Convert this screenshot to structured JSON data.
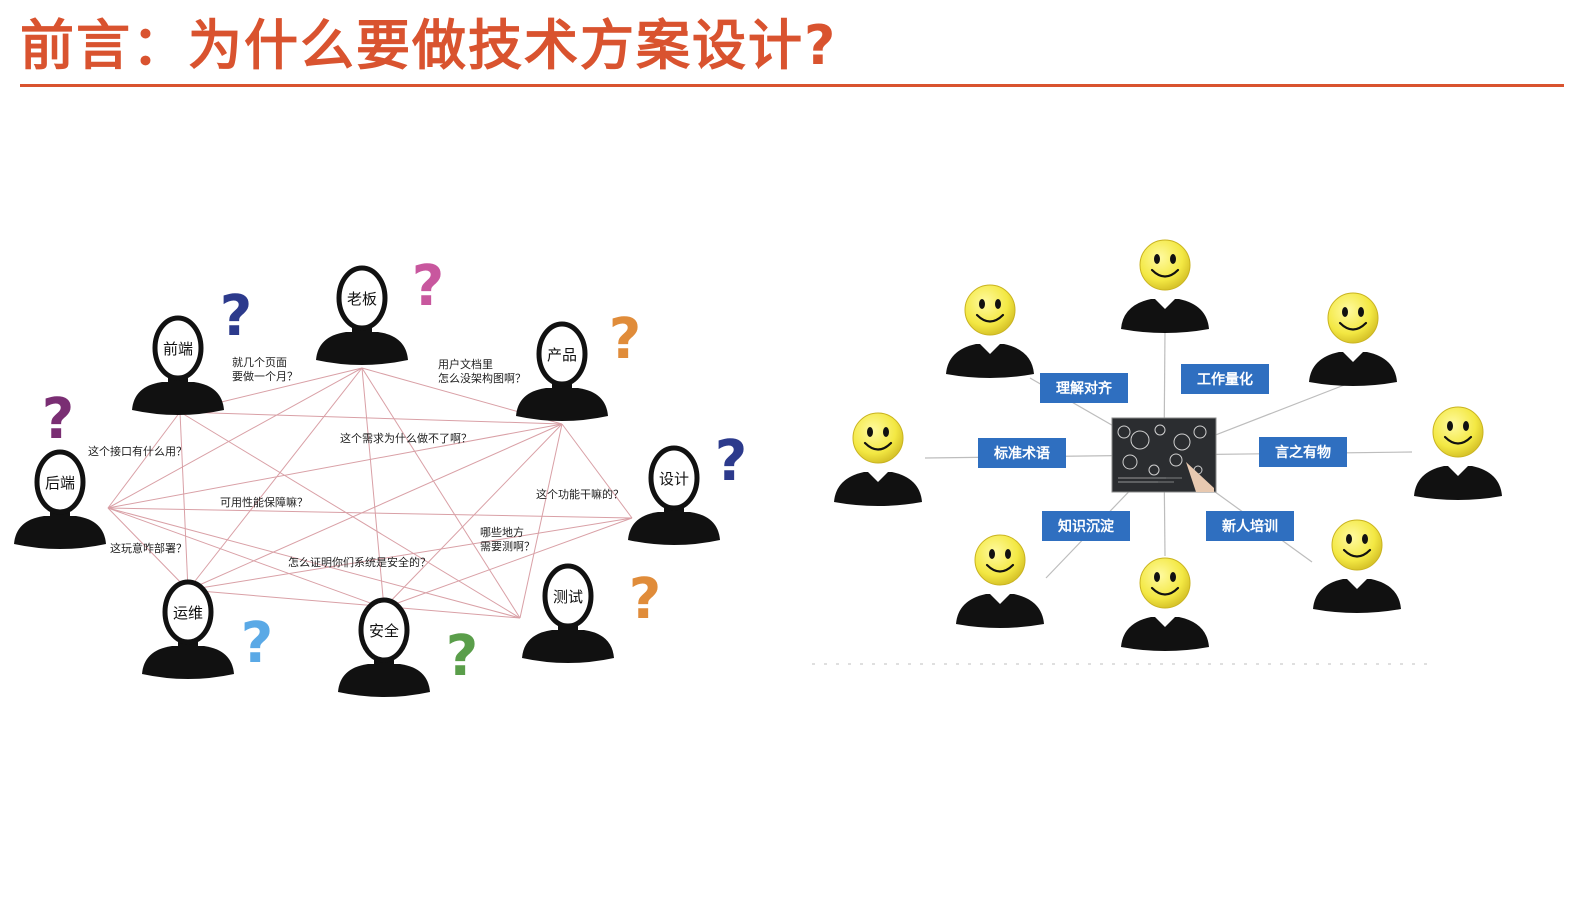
{
  "title": "前言：为什么要做技术方案设计?",
  "colors": {
    "title": "#d9532f",
    "line": "#d9a0a6",
    "tag_bg": "#2f6fc0",
    "smiley": "#f3e843"
  },
  "left_diagram": {
    "roles": [
      {
        "id": "boss",
        "label": "老板",
        "q_color": "#c8579e"
      },
      {
        "id": "frontend",
        "label": "前端",
        "q_color": "#2c3a8c"
      },
      {
        "id": "product",
        "label": "产品",
        "q_color": "#e08c3a"
      },
      {
        "id": "backend",
        "label": "后端",
        "q_color": "#7a2e73"
      },
      {
        "id": "design",
        "label": "设计",
        "q_color": "#2c3a8c"
      },
      {
        "id": "ops",
        "label": "运维",
        "q_color": "#5aa9e6"
      },
      {
        "id": "security",
        "label": "安全",
        "q_color": "#5a9e4a"
      },
      {
        "id": "qa",
        "label": "测试",
        "q_color": "#e08c3a"
      }
    ],
    "question_glyph": "?",
    "questions": [
      {
        "lines": [
          "就几个页面",
          "要做一个月？"
        ]
      },
      {
        "lines": [
          "用户文档里",
          "怎么没架构图啊？"
        ]
      },
      {
        "lines": [
          "这个接口有什么用？"
        ]
      },
      {
        "lines": [
          "这个需求为什么做不了啊？"
        ]
      },
      {
        "lines": [
          "可用性能保障嘛？"
        ]
      },
      {
        "lines": [
          "这个功能干嘛的？"
        ]
      },
      {
        "lines": [
          "哪些地方",
          "需要测啊？"
        ]
      },
      {
        "lines": [
          "这玩意咋部署？"
        ]
      },
      {
        "lines": [
          "怎么证明你们系统是安全的？"
        ]
      }
    ]
  },
  "right_diagram": {
    "center_image": "blackboard-image",
    "tags": [
      {
        "label": "理解对齐"
      },
      {
        "label": "工作量化"
      },
      {
        "label": "标准术语"
      },
      {
        "label": "言之有物"
      },
      {
        "label": "知识沉淀"
      },
      {
        "label": "新人培训"
      }
    ]
  }
}
